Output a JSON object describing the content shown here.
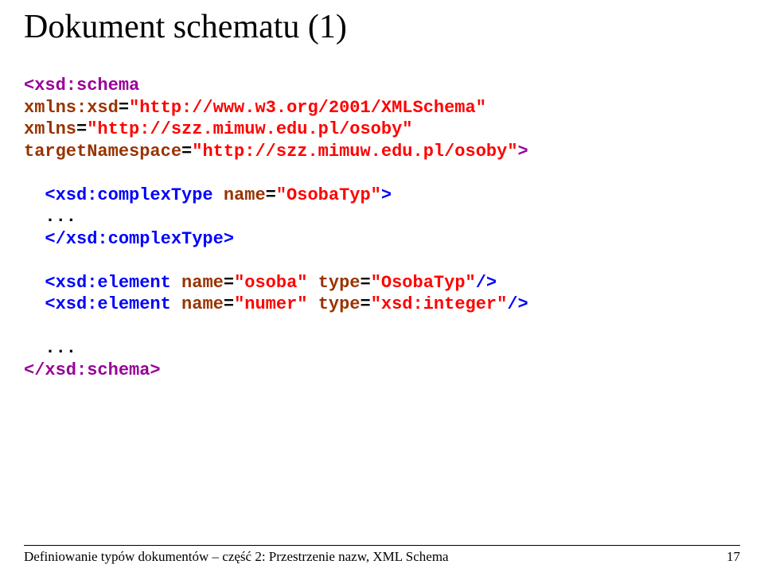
{
  "title": "Dokument schematu (1)",
  "code": {
    "line1": {
      "tag_open": "<xsd:schema"
    },
    "line2": {
      "attr": "xmlns:xsd",
      "eq": "=",
      "val": "\"http://www.w3.org/2001/XMLSchema\""
    },
    "line3": {
      "attr": "xmlns",
      "eq": "=",
      "val": "\"http://szz.mimuw.edu.pl/osoby\""
    },
    "line4": {
      "attr": "targetNamespace",
      "eq": "=",
      "val": "\"http://szz.mimuw.edu.pl/osoby\"",
      "close": ">"
    },
    "line6": {
      "open": "  <xsd:complexType ",
      "attr": "name",
      "eq": "=",
      "val": "\"OsobaTyp\"",
      "close": ">"
    },
    "line7": {
      "dots": "  ..."
    },
    "line8": {
      "tag": "  </xsd:complexType>"
    },
    "line10": {
      "open": "  <xsd:element ",
      "attr1": "name",
      "eq1": "=",
      "val1": "\"osoba\"",
      "sp1": " ",
      "attr2": "type",
      "eq2": "=",
      "val2": "\"OsobaTyp\"",
      "close": "/>"
    },
    "line11": {
      "open": "  <xsd:element ",
      "attr1": "name",
      "eq1": "=",
      "val1": "\"numer\"",
      "sp1": " ",
      "attr2": "type",
      "eq2": "=",
      "val2": "\"xsd:integer\"",
      "close": "/>"
    },
    "line13": {
      "dots": "  ..."
    },
    "line14": {
      "tag": "</xsd:schema>"
    }
  },
  "footer": {
    "text": "Definiowanie typów dokumentów – część 2: Przestrzenie nazw, XML Schema",
    "page": "17"
  }
}
